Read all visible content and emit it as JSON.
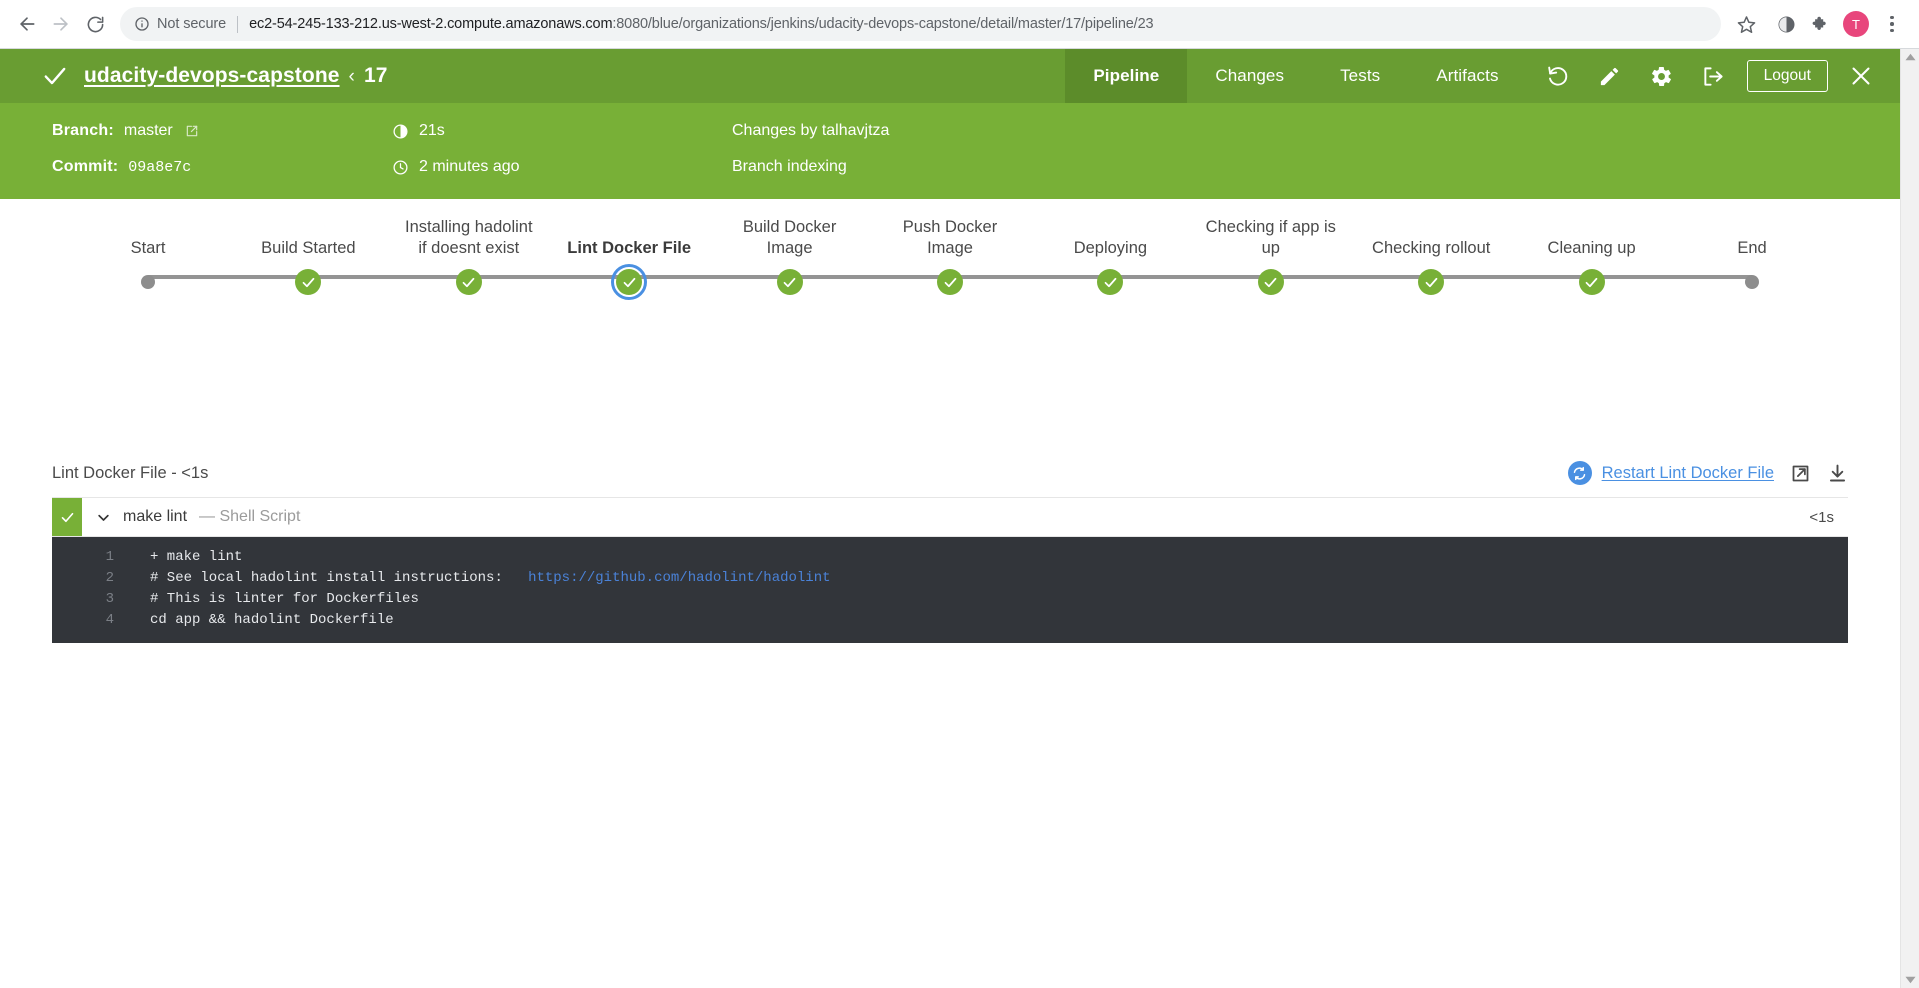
{
  "browser": {
    "back_icon": "back-arrow-icon",
    "forward_icon": "forward-arrow-icon",
    "reload_icon": "reload-icon",
    "security_label": "Not secure",
    "url_host": "ec2-54-245-133-212.us-west-2.compute.amazonaws.com",
    "url_path": ":8080/blue/organizations/jenkins/udacity-devops-capstone/detail/master/17/pipeline/23",
    "bookmark_icon": "star-icon",
    "profile_initial": "T",
    "menu_icon": "kebab-menu-icon"
  },
  "header": {
    "status_icon": "check-icon",
    "project_name": "udacity-devops-capstone",
    "caret": "‹",
    "run_number": "17",
    "tabs": [
      {
        "label": "Pipeline",
        "active": true
      },
      {
        "label": "Changes",
        "active": false
      },
      {
        "label": "Tests",
        "active": false
      },
      {
        "label": "Artifacts",
        "active": false
      }
    ],
    "actions": {
      "rerun_icon": "rerun-icon",
      "edit_icon": "pencil-edit-icon",
      "settings_icon": "gear-icon",
      "exit_icon": "exit-to-classic-icon",
      "logout_label": "Logout",
      "close_icon": "close-x-icon"
    },
    "colors": {
      "header_green": "#699d32",
      "meta_green": "#78b037",
      "tab_active_green": "#5c8c2a"
    }
  },
  "meta": {
    "branch_label": "Branch:",
    "branch_value": "master",
    "branch_link_icon": "external-link-icon",
    "commit_label": "Commit:",
    "commit_value": "09a8e7c",
    "duration_icon": "duration-icon",
    "duration_value": "21s",
    "time_icon": "clock-icon",
    "time_value": "2 minutes ago",
    "changes_by": "Changes by talhavjtza",
    "cause": "Branch indexing"
  },
  "pipeline": {
    "stages": [
      {
        "label": "Start",
        "type": "terminal",
        "selected": false
      },
      {
        "label": "Build Started",
        "type": "success",
        "selected": false
      },
      {
        "label": "Installing hadolint\nif doesnt exist",
        "type": "success",
        "selected": false
      },
      {
        "label": "Lint Docker File",
        "type": "success",
        "selected": true
      },
      {
        "label": "Build Docker\nImage",
        "type": "success",
        "selected": false
      },
      {
        "label": "Push Docker\nImage",
        "type": "success",
        "selected": false
      },
      {
        "label": "Deploying",
        "type": "success",
        "selected": false
      },
      {
        "label": "Checking if app is\nup",
        "type": "success",
        "selected": false
      },
      {
        "label": "Checking rollout",
        "type": "success",
        "selected": false
      },
      {
        "label": "Cleaning up",
        "type": "success",
        "selected": false
      },
      {
        "label": "End",
        "type": "terminal",
        "selected": false
      }
    ],
    "selected_ring_color": "#4a90e2",
    "node_success_color": "#78b037",
    "node_terminal_color": "#8d8d8d"
  },
  "log": {
    "title": "Lint Docker File - <1s",
    "restart_label": "Restart Lint Docker File",
    "restart_icon": "restart-circle-icon",
    "open_external_icon": "open-in-new-icon",
    "download_icon": "download-icon",
    "step": {
      "status_icon": "check-icon",
      "expand_icon": "chevron-down-icon",
      "name": "make lint",
      "type": "— Shell Script",
      "duration": "<1s"
    },
    "console_lines": [
      {
        "num": "1",
        "text": "+ make lint"
      },
      {
        "num": "2",
        "text": "# See local hadolint install instructions:   ",
        "link": "https://github.com/hadolint/hadolint"
      },
      {
        "num": "3",
        "text": "# This is linter for Dockerfiles"
      },
      {
        "num": "4",
        "text": "cd app && hadolint Dockerfile"
      }
    ]
  },
  "scrollbar": {
    "up_icon": "scroll-up-arrow-icon",
    "down_icon": "scroll-down-arrow-icon"
  }
}
